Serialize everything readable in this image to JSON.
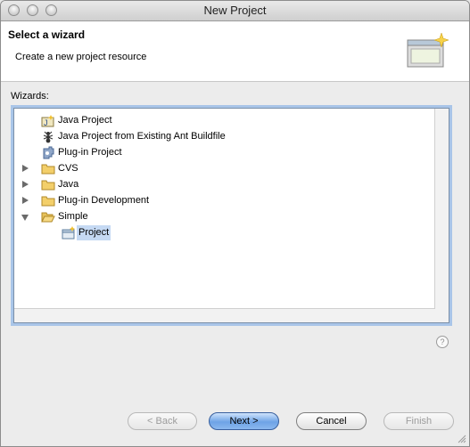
{
  "window": {
    "title": "New Project"
  },
  "banner": {
    "title": "Select a wizard",
    "description": "Create a new project resource",
    "image_icon": "wizard-banner-icon"
  },
  "wizards_label": "Wizards:",
  "tree": [
    {
      "label": "Java Project",
      "icon": "java-project-icon",
      "level": 0
    },
    {
      "label": "Java Project from Existing Ant Buildfile",
      "icon": "ant-icon",
      "level": 0
    },
    {
      "label": "Plug-in Project",
      "icon": "plugin-project-icon",
      "level": 0
    },
    {
      "label": "CVS",
      "icon": "folder-icon",
      "level": 0,
      "expander": "collapsed"
    },
    {
      "label": "Java",
      "icon": "folder-icon",
      "level": 0,
      "expander": "collapsed"
    },
    {
      "label": "Plug-in Development",
      "icon": "folder-icon",
      "level": 0,
      "expander": "collapsed"
    },
    {
      "label": "Simple",
      "icon": "folder-open-icon",
      "level": 0,
      "expander": "expanded"
    },
    {
      "label": "Project",
      "icon": "new-project-icon",
      "level": 1,
      "selected": true
    }
  ],
  "help": {
    "label": "?"
  },
  "buttons": {
    "back": "< Back",
    "next": "Next >",
    "cancel": "Cancel",
    "finish": "Finish"
  },
  "colors": {
    "selection": "#c5d9f3",
    "focus_ring": "#a9c5e8",
    "default_button": "#6ea3e6"
  }
}
